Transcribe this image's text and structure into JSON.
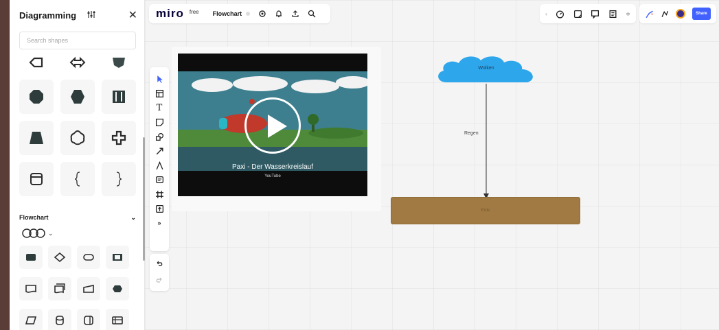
{
  "panel": {
    "title": "Diagramming",
    "search_placeholder": "Search shapes",
    "flowchart_section": "Flowchart",
    "flowchart_collapse_icon": "chevron-down-icon"
  },
  "topbar": {
    "logo": "miro",
    "plan": "free",
    "board_name": "Flowchart"
  },
  "collab": {
    "share_label": "Share",
    "accent": "#4262ff"
  },
  "video": {
    "title": "Paxi - Der Wasserkreislauf",
    "source": "YouTube"
  },
  "diagram": {
    "cloud_label": "Wolken",
    "edge_label": "Regen",
    "ground_label": "Erde",
    "cloud_color": "#2ea6ec",
    "ground_color": "#a07a42"
  }
}
